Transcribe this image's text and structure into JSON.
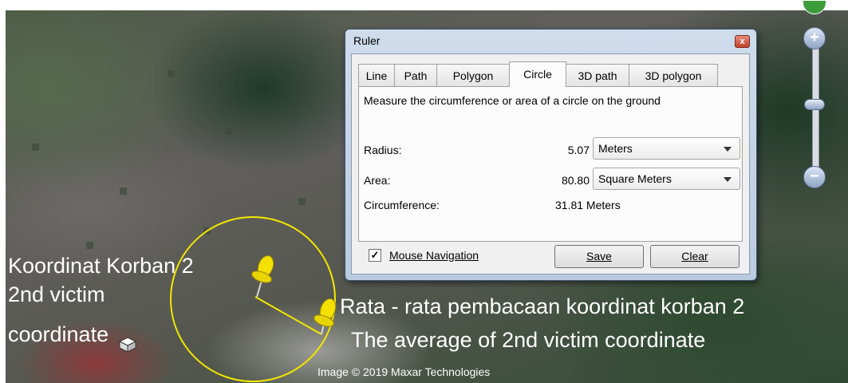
{
  "map": {
    "labels_left": [
      "Koordinat Korban 2",
      "2nd victim",
      "coordinate"
    ],
    "labels_right": [
      "Rata - rata pembacaan koordinat korban 2",
      "The average of 2nd victim coordinate"
    ],
    "attribution": "Image © 2019 Maxar Technologies",
    "circle_color": "#f2e600",
    "pin_color": "#f5e000"
  },
  "zoom": {
    "plus": "+",
    "minus": "−"
  },
  "dialog": {
    "title": "Ruler",
    "close": "x",
    "tabs": [
      "Line",
      "Path",
      "Polygon",
      "Circle",
      "3D path",
      "3D polygon"
    ],
    "active_tab": "Circle",
    "description": "Measure the circumference or area of a circle on the ground",
    "radius": {
      "label": "Radius:",
      "value": "5.07",
      "unit": "Meters"
    },
    "area": {
      "label": "Area:",
      "value": "80.80",
      "unit": "Square Meters"
    },
    "circumference": {
      "label": "Circumference:",
      "value": "31.81 Meters"
    },
    "mouse_navigation": {
      "label": "Mouse Navigation",
      "checked": true,
      "mark": "✓"
    },
    "save": "Save",
    "clear": "Clear"
  }
}
